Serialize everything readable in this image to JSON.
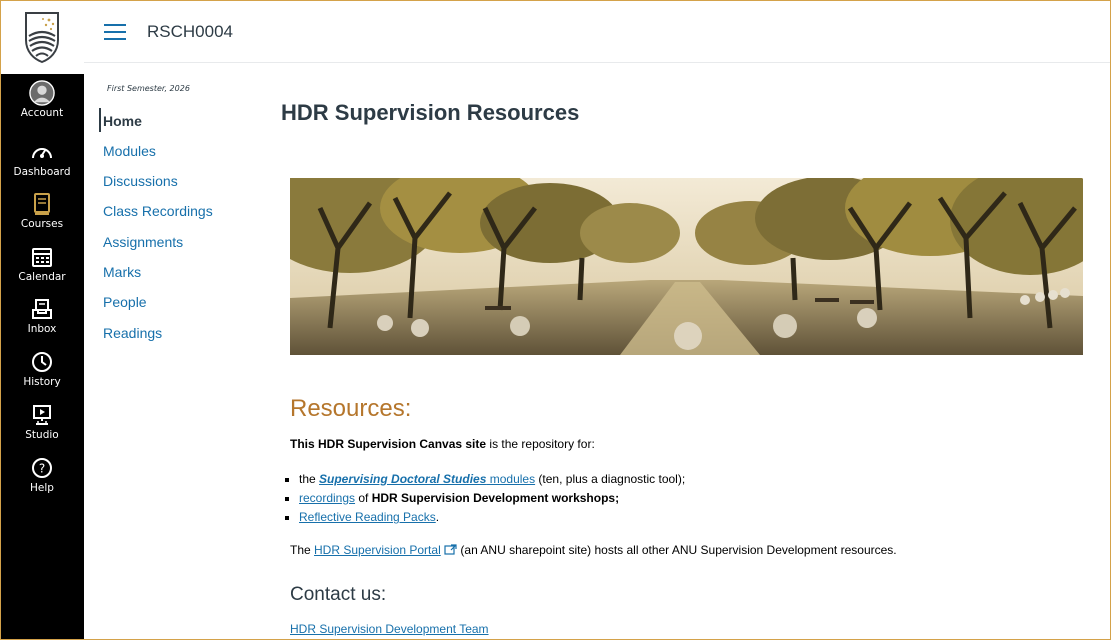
{
  "global_nav": {
    "logo_icon": "anu-crest-logo",
    "items": [
      {
        "label": "Account",
        "icon": "account-avatar-icon"
      },
      {
        "label": "Dashboard",
        "icon": "dashboard-icon"
      },
      {
        "label": "Courses",
        "icon": "courses-book-icon"
      },
      {
        "label": "Calendar",
        "icon": "calendar-icon"
      },
      {
        "label": "Inbox",
        "icon": "inbox-icon"
      },
      {
        "label": "History",
        "icon": "history-clock-icon"
      },
      {
        "label": "Studio",
        "icon": "studio-icon"
      },
      {
        "label": "Help",
        "icon": "help-question-icon"
      }
    ],
    "active": "Courses"
  },
  "header": {
    "menu_icon": "hamburger-menu-icon",
    "breadcrumb": "RSCH0004"
  },
  "course_nav": {
    "term": "First Semester, 2026",
    "items": [
      {
        "label": "Home"
      },
      {
        "label": "Modules"
      },
      {
        "label": "Discussions"
      },
      {
        "label": "Class Recordings"
      },
      {
        "label": "Assignments"
      },
      {
        "label": "Marks"
      },
      {
        "label": "People"
      },
      {
        "label": "Readings"
      }
    ],
    "current": "Home"
  },
  "main": {
    "title": "HDR Supervision Resources",
    "banner_icon": "tree-lined-campus-avenue-image",
    "resources_heading": "Resources:",
    "intro_bold": "This HDR Supervision Canvas site",
    "intro_rest": " is the repository for:",
    "list": {
      "item1_prefix": "the ",
      "item1_link_bold": "Supervising Doctoral Studies",
      "item1_link_rest": " modules",
      "item1_suffix": " (ten, plus a diagnostic tool);",
      "item2_link": "recordings",
      "item2_mid": " of ",
      "item2_bold": "HDR Supervision Development workshops;",
      "item3_link": "Reflective Reading Packs",
      "item3_suffix": "."
    },
    "portal_prefix": "The ",
    "portal_link": "HDR Supervision Portal",
    "portal_icon": "external-link-icon",
    "portal_suffix": " (an ANU sharepoint site) hosts all other ANU Supervision Development resources.",
    "contact_heading": "Contact us:",
    "contact_link": "HDR Supervision Development Team"
  },
  "colors": {
    "nav_bg": "#000000",
    "link": "#1770ab",
    "heading_accent": "#b5762c",
    "frame_border": "#d4a24a"
  }
}
